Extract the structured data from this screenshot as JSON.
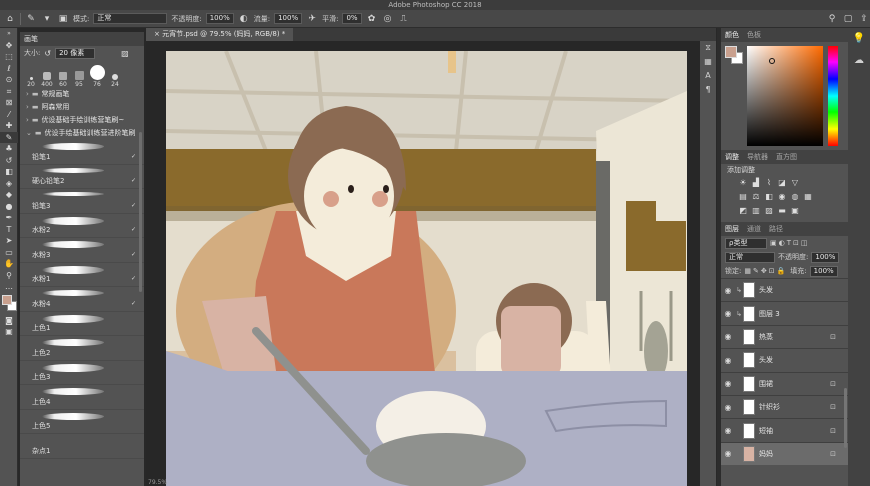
{
  "app": {
    "title": "Adobe Photoshop CC 2018"
  },
  "options_bar": {
    "mode_label": "模式:",
    "mode_value": "正常",
    "opacity_label": "不透明度:",
    "opacity_value": "100%",
    "flow_label": "流量:",
    "flow_value": "100%",
    "smoothing_label": "平滑:",
    "smoothing_value": "0%"
  },
  "document": {
    "tab_title": "元宵节.psd @ 79.5% (妈妈, RGB/8) *"
  },
  "status": {
    "text": "79.5%"
  },
  "brush_panel": {
    "title": "画笔",
    "size_label": "大小:",
    "size_value": "20 像素",
    "presets": [
      {
        "size": "20"
      },
      {
        "size": "400"
      },
      {
        "size": "60"
      },
      {
        "size": "95"
      },
      {
        "size": "76"
      },
      {
        "size": "24"
      }
    ],
    "folders": [
      {
        "label": "常规画笔"
      },
      {
        "label": "阿森常用"
      },
      {
        "label": "优设基础手绘训练营笔刷~"
      },
      {
        "label": "优设手绘基础训练营进阶笔刷"
      }
    ],
    "brushes": [
      {
        "label": "铅笔1"
      },
      {
        "label": "硬心铅笔2"
      },
      {
        "label": "铅笔3"
      },
      {
        "label": "水粉2"
      },
      {
        "label": "水粉3"
      },
      {
        "label": "水粉1"
      },
      {
        "label": "水粉4"
      },
      {
        "label": "上色1"
      },
      {
        "label": "上色2"
      },
      {
        "label": "上色3"
      },
      {
        "label": "上色4"
      },
      {
        "label": "上色5"
      },
      {
        "label": "杂点1"
      }
    ]
  },
  "color_panel": {
    "tabs": [
      "颜色",
      "色板"
    ],
    "fg_color": "#c9a08e",
    "bg_color": "#ffffff"
  },
  "adjust_panel": {
    "tabs": [
      "调整",
      "导航器",
      "直方图"
    ],
    "title": "添加调整"
  },
  "layers_panel": {
    "tabs": [
      "图层",
      "通道",
      "路径"
    ],
    "filter_value": "ρ类型",
    "blend_value": "正常",
    "opacity_label": "不透明度:",
    "opacity_value": "100%",
    "lock_label": "锁定:",
    "fill_label": "填充:",
    "fill_value": "100%",
    "layers": [
      {
        "name": "头发",
        "clipped": true,
        "locked": false,
        "selected": false
      },
      {
        "name": "图层 3",
        "clipped": true,
        "locked": false,
        "selected": false
      },
      {
        "name": "热蒸",
        "clipped": false,
        "locked": true,
        "selected": false
      },
      {
        "name": "头发",
        "clipped": false,
        "locked": false,
        "selected": false
      },
      {
        "name": "围裙",
        "clipped": false,
        "locked": true,
        "selected": false
      },
      {
        "name": "针织衫",
        "clipped": false,
        "locked": true,
        "selected": false
      },
      {
        "name": "短袖",
        "clipped": false,
        "locked": true,
        "selected": false
      },
      {
        "name": "妈妈",
        "clipped": false,
        "locked": true,
        "selected": true
      }
    ]
  }
}
